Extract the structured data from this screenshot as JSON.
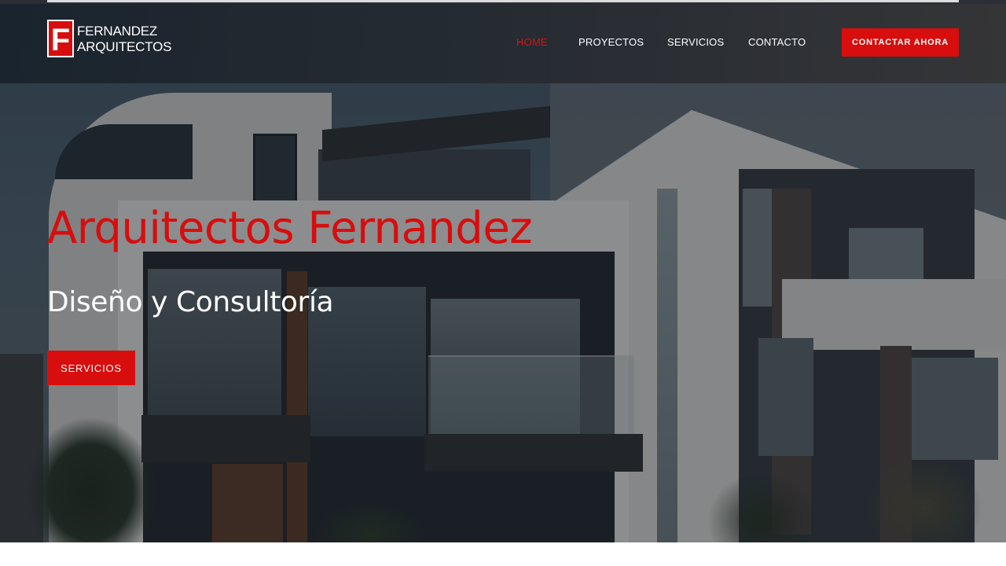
{
  "brand": {
    "logo_letter": "F",
    "line1": "FERNANDEZ",
    "line2": "ARQUITECTOS",
    "accent_color": "#d80d0d"
  },
  "nav": {
    "items": [
      {
        "label": "HOME",
        "active": true
      },
      {
        "label": "PROYECTOS",
        "active": false
      },
      {
        "label": "SERVICIOS",
        "active": false
      },
      {
        "label": "CONTACTO",
        "active": false
      }
    ],
    "cta_label": "CONTACTAR AHORA"
  },
  "hero": {
    "title": "Arquitectos Fernandez",
    "subtitle": "Diseño y Consultoría",
    "button_label": "SERVICIOS",
    "background_image": "modern-house-photo"
  }
}
